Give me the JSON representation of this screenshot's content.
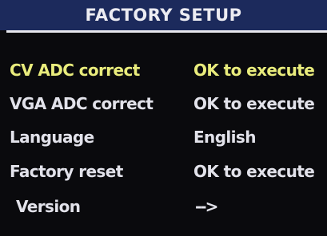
{
  "title": "FACTORY SETUP",
  "colors": {
    "title_bar_bg": "#1c2a5c",
    "screen_bg": "#0a0a0d",
    "text": "#e2e2ea",
    "selected_text": "#e9ec7c"
  },
  "menu": {
    "items": [
      {
        "label": "CV ADC correct",
        "value": "OK to execute",
        "selected": true
      },
      {
        "label": "VGA ADC correct",
        "value": "OK to execute",
        "selected": false
      },
      {
        "label": "Language",
        "value": "English",
        "selected": false
      },
      {
        "label": "Factory reset",
        "value": "OK to execute",
        "selected": false
      },
      {
        "label": "Version",
        "value": "-->",
        "selected": false
      }
    ]
  }
}
